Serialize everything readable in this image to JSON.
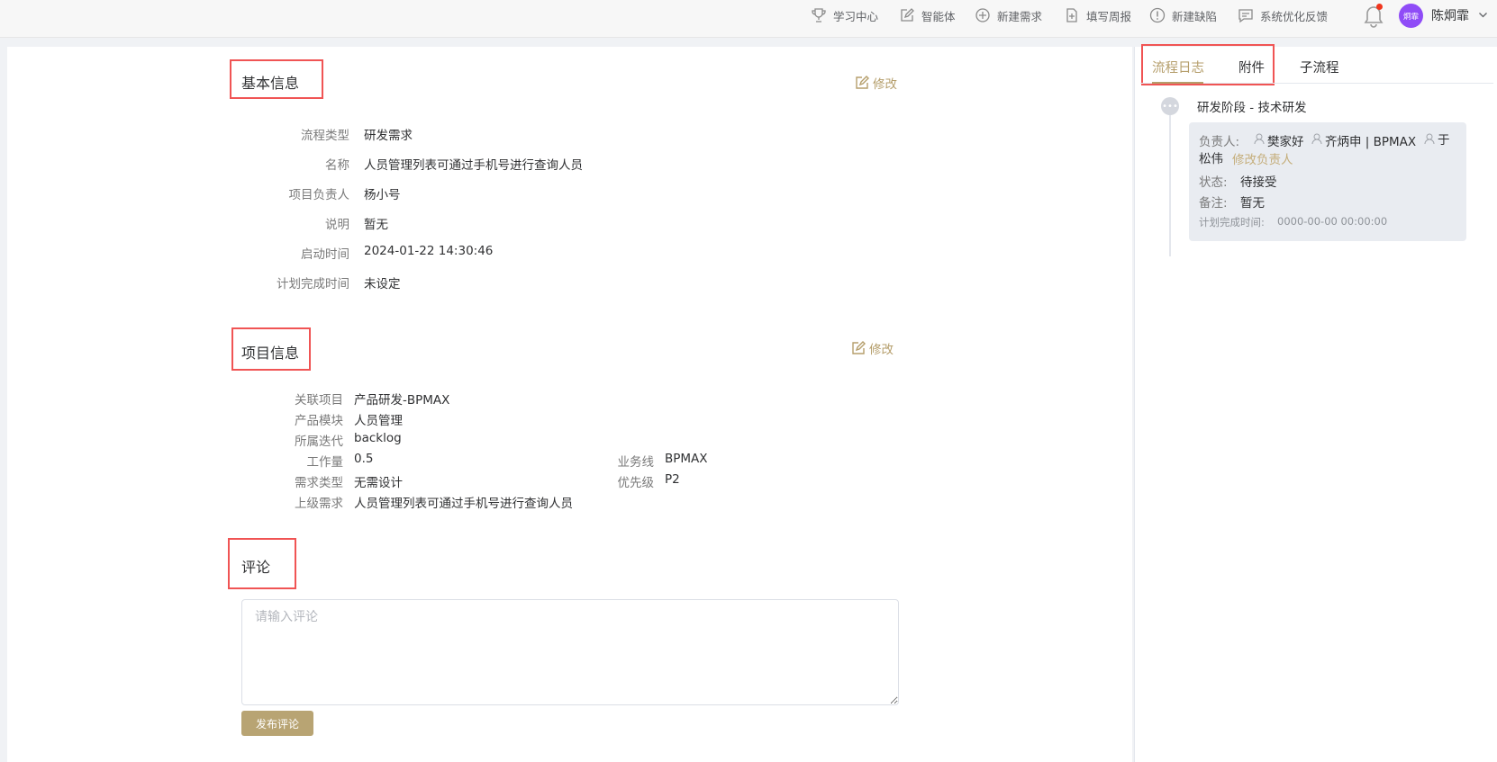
{
  "topbar": {
    "nav": [
      {
        "label": "学习中心",
        "icon": "trophy-icon"
      },
      {
        "label": "智能体",
        "icon": "edit-square-icon"
      },
      {
        "label": "新建需求",
        "icon": "plus-circle-icon"
      },
      {
        "label": "填写周报",
        "icon": "add-file-icon"
      },
      {
        "label": "新建缺陷",
        "icon": "exclamation-circle-icon"
      },
      {
        "label": "系统优化反馈",
        "icon": "feedback-icon"
      }
    ],
    "avatar_text": "炯霏",
    "username": "陈炯霏"
  },
  "basic_info": {
    "title": "基本信息",
    "edit_label": "修改",
    "fields": [
      {
        "label": "流程类型",
        "value": "研发需求"
      },
      {
        "label": "名称",
        "value": "人员管理列表可通过手机号进行查询人员"
      },
      {
        "label": "项目负责人",
        "value": "杨小号"
      },
      {
        "label": "说明",
        "value": "暂无"
      },
      {
        "label": "启动时间",
        "value": "2024-01-22 14:30:46"
      },
      {
        "label": "计划完成时间",
        "value": "未设定"
      }
    ]
  },
  "project_info": {
    "title": "项目信息",
    "edit_label": "修改",
    "fields": [
      {
        "label": "关联项目",
        "value": "产品研发-BPMAX"
      },
      {
        "label": "产品模块",
        "value": "人员管理"
      },
      {
        "label": "所属迭代",
        "value": "backlog"
      },
      {
        "label": "工作量",
        "value": "0.5"
      },
      {
        "label": "需求类型",
        "value": "无需设计"
      },
      {
        "label": "上级需求",
        "value": "人员管理列表可通过手机号进行查询人员"
      }
    ],
    "right_fields": [
      {
        "label": "业务线",
        "value": "BPMAX"
      },
      {
        "label": "优先级",
        "value": "P2"
      }
    ]
  },
  "comment": {
    "title": "评论",
    "placeholder": "请输入评论",
    "submit_label": "发布评论"
  },
  "right_panel": {
    "tabs": [
      {
        "label": "流程日志",
        "active": true
      },
      {
        "label": "附件",
        "active": false
      },
      {
        "label": "子流程",
        "active": false
      }
    ],
    "stage": {
      "title": "研发阶段 - 技术研发",
      "owner_label": "负责人:",
      "owners": [
        "樊家好",
        "齐炳申 | BPMAX",
        "于松伟"
      ],
      "change_owner_label": "修改负责人",
      "status_label": "状态:",
      "status_value": "待接受",
      "note_label": "备注:",
      "note_value": "暂无",
      "plan_label": "计划完成时间:",
      "plan_value": "0000-00-00 00:00:00"
    }
  },
  "colors": {
    "accent": "#b59e6b",
    "button": "#b8a473",
    "highlight_box": "#f05454",
    "avatar": "#8f4cf7"
  }
}
